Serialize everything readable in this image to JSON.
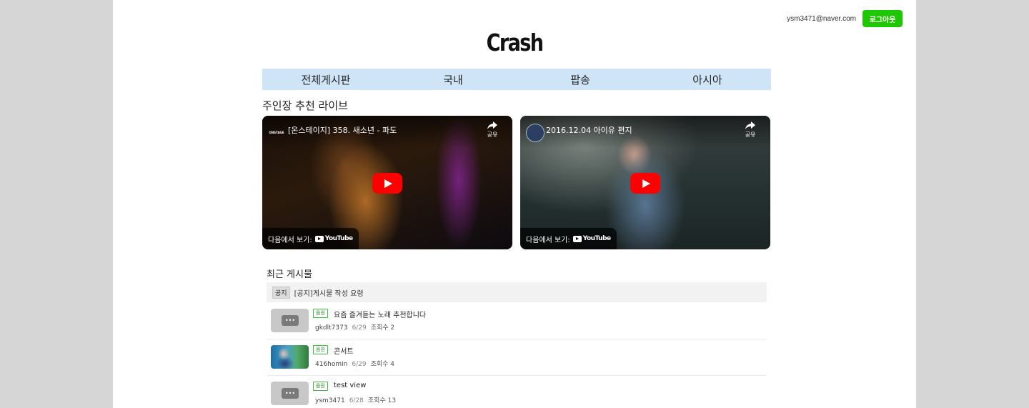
{
  "header": {
    "user_email": "ysm3471@naver.com",
    "logout_label": "로그아웃",
    "logo": "Crash"
  },
  "nav": {
    "items": [
      {
        "label": "전체게시판"
      },
      {
        "label": "국내"
      },
      {
        "label": "팝송"
      },
      {
        "label": "아시아"
      }
    ]
  },
  "recommend": {
    "title": "주인장 추천 라이브",
    "videos": [
      {
        "channel_logo_text": "ONSTAGE",
        "title": "[온스테이지] 358. 새소년 - 파도",
        "share_label": "공유",
        "watch_on_label": "다음에서 보기:",
        "youtube_label": "YouTube"
      },
      {
        "title": "2016.12.04 아이유 편지",
        "share_label": "공유",
        "watch_on_label": "다음에서 보기:",
        "youtube_label": "YouTube"
      }
    ]
  },
  "recent": {
    "title": "최근 게시물",
    "notice": {
      "badge": "공지",
      "title": "[공지]게시물 작성 요령"
    },
    "posts": [
      {
        "badge": "음원",
        "title": "요즘 즐겨듣는 노래 추천합니다",
        "author": "gkdlt7373",
        "date": "6/29",
        "views": "조회수 2",
        "thumb": "placeholder"
      },
      {
        "badge": "음원",
        "title": "콘서트",
        "author": "416homin",
        "date": "6/29",
        "views": "조회수 4",
        "thumb": "photo"
      },
      {
        "badge": "음원",
        "title": "test view",
        "author": "ysm3471",
        "date": "6/28",
        "views": "조회수 13",
        "thumb": "placeholder"
      }
    ]
  },
  "colors": {
    "nav_bg": "#cfe5f7",
    "logout_bg": "#1ec800",
    "play_button": "#ff0000",
    "badge_border": "#3cc33c"
  }
}
